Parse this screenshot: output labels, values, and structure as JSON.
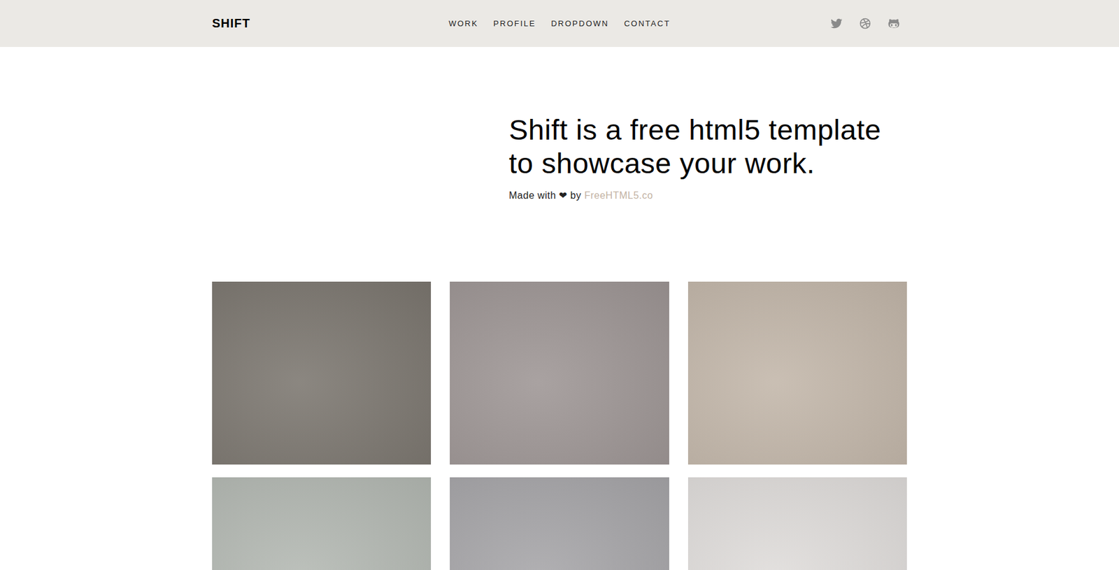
{
  "header": {
    "logo": "SHIFT",
    "nav": [
      {
        "label": "WORK"
      },
      {
        "label": "PROFILE"
      },
      {
        "label": "DROPDOWN"
      },
      {
        "label": "CONTACT"
      }
    ],
    "social": [
      "twitter",
      "dribbble",
      "github"
    ]
  },
  "hero": {
    "title": "Shift is a free html5 template to showcase your work.",
    "subtitle": {
      "prefix": "Made with",
      "heart": "❤",
      "by": "by",
      "link": "FreeHTML5.co"
    }
  },
  "work": [
    {
      "color": "#7b766f"
    },
    {
      "color": "#9d9594"
    },
    {
      "color": "#c2b6a9"
    },
    {
      "color": "#b3b8b2"
    },
    {
      "color": "#a6a5a8"
    },
    {
      "color": "#dfdcda"
    }
  ]
}
